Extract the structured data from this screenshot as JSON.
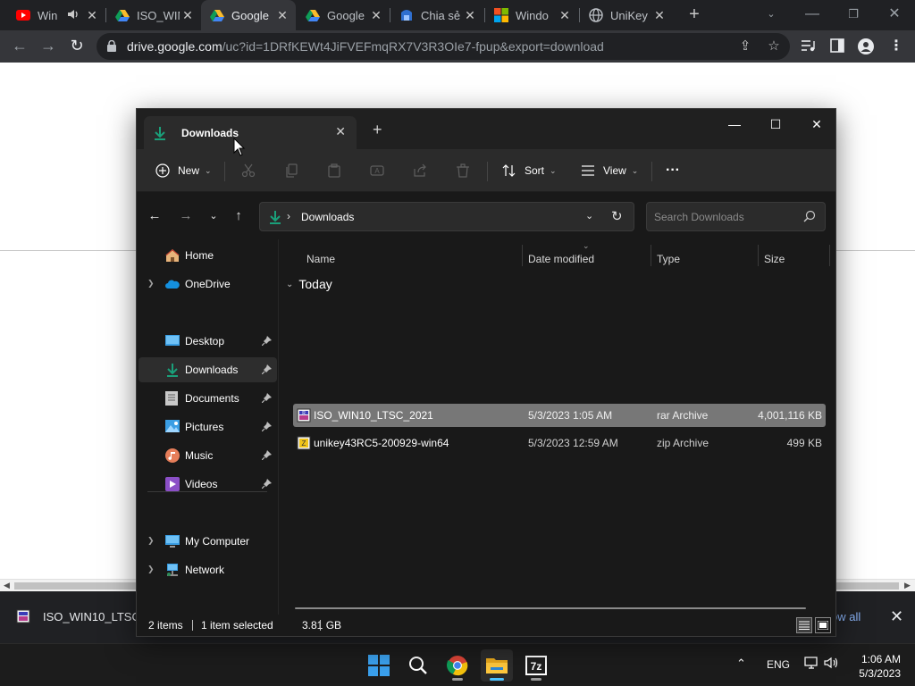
{
  "browser": {
    "tabs": [
      {
        "title": "Win",
        "favicon": "youtube-icon",
        "audio": true
      },
      {
        "title": "ISO_WIN",
        "favicon": "google-drive-icon"
      },
      {
        "title": "Google",
        "favicon": "google-drive-icon",
        "active": true
      },
      {
        "title": "Google",
        "favicon": "google-drive-icon"
      },
      {
        "title": "Chia sẻ",
        "favicon": "share-icon"
      },
      {
        "title": "Windo",
        "favicon": "microsoft-icon"
      },
      {
        "title": "UniKey",
        "favicon": "globe-icon"
      }
    ],
    "url_host": "drive.google.com",
    "url_rest": "/uc?id=1DRfKEWt4JiFVEFmqRX7V3R3OIe7-fpup&export=download",
    "colors": {
      "chrome_dark": "#202124",
      "toolbar": "#35363a",
      "link": "#8ab4f8"
    }
  },
  "download_bar": {
    "filename": "ISO_WIN10_LTSC_",
    "show_all": "ow all"
  },
  "explorer": {
    "tab_title": "Downloads",
    "commands": {
      "new": "New",
      "sort": "Sort",
      "view": "View"
    },
    "address": {
      "crumb": "Downloads"
    },
    "search": {
      "placeholder": "Search Downloads"
    },
    "nav": {
      "home": "Home",
      "onedrive": "OneDrive",
      "desktop": "Desktop",
      "downloads": "Downloads",
      "documents": "Documents",
      "pictures": "Pictures",
      "music": "Music",
      "videos": "Videos",
      "my_computer": "My Computer",
      "network": "Network"
    },
    "columns": {
      "name": "Name",
      "date": "Date modified",
      "type": "Type",
      "size": "Size"
    },
    "group": "Today",
    "files": [
      {
        "name": "ISO_WIN10_LTSC_2021",
        "date": "5/3/2023 1:05 AM",
        "type": "rar Archive",
        "size": "4,001,116 KB",
        "selected": true
      },
      {
        "name": "unikey43RC5-200929-win64",
        "date": "5/3/2023 12:59 AM",
        "type": "zip Archive",
        "size": "499 KB",
        "selected": false
      }
    ],
    "status": {
      "items": "2 items",
      "selected": "1 item selected",
      "size": "3.81 GB"
    },
    "colors": {
      "background": "#191919",
      "command_bar": "#2b2b2b",
      "selection": "#777777",
      "accent": "#1aa07a"
    }
  },
  "taskbar": {
    "language": "ENG",
    "time": "1:06 AM",
    "date": "5/3/2023",
    "apps": [
      "windows-start-icon",
      "search-icon",
      "chrome-icon",
      "file-explorer-icon",
      "7zip-icon"
    ]
  }
}
